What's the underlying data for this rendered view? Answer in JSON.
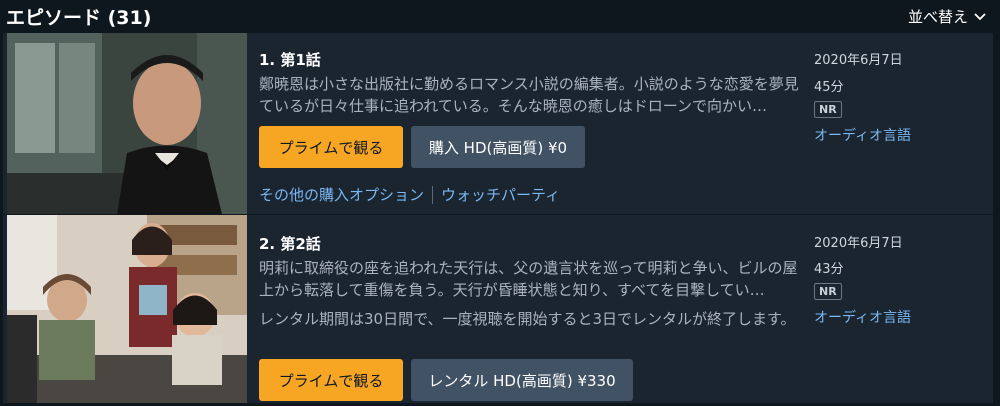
{
  "header": {
    "title": "エピソード (31)",
    "sort_label": "並べ替え"
  },
  "episodes": [
    {
      "title": "1. 第1話",
      "description": "鄭暁恩は小さな出版社に勤めるロマンス小説の編集者。小説のような恋愛を夢見ているが日々仕事に追われている。そんな暁恩の癒しはドローンで向かい…",
      "note": "",
      "prime_button": "プライムで観る",
      "buy_button": "購入 HD(高画質) ¥0",
      "links": [
        "その他の購入オプション",
        "ウォッチパーティ"
      ],
      "date": "2020年6月7日",
      "duration": "45分",
      "rating": "NR",
      "audio": "オーディオ言語"
    },
    {
      "title": "2. 第2話",
      "description": "明莉に取締役の座を追われた天行は、父の遺言状を巡って明莉と争い、ビルの屋上から転落して重傷を負う。天行が昏睡状態と知り、すべてを目撃してい…",
      "note": "レンタル期間は30日間で、一度視聴を開始すると3日でレンタルが終了します。",
      "prime_button": "プライムで観る",
      "buy_button": "レンタル HD(高画質) ¥330",
      "links": [],
      "date": "2020年6月7日",
      "duration": "43分",
      "rating": "NR",
      "audio": "オーディオ言語"
    }
  ],
  "colors": {
    "background": "#0f171e",
    "card": "#1b2530",
    "prime": "#f6a623",
    "link": "#79b8f3",
    "secondary_button": "#425265"
  }
}
